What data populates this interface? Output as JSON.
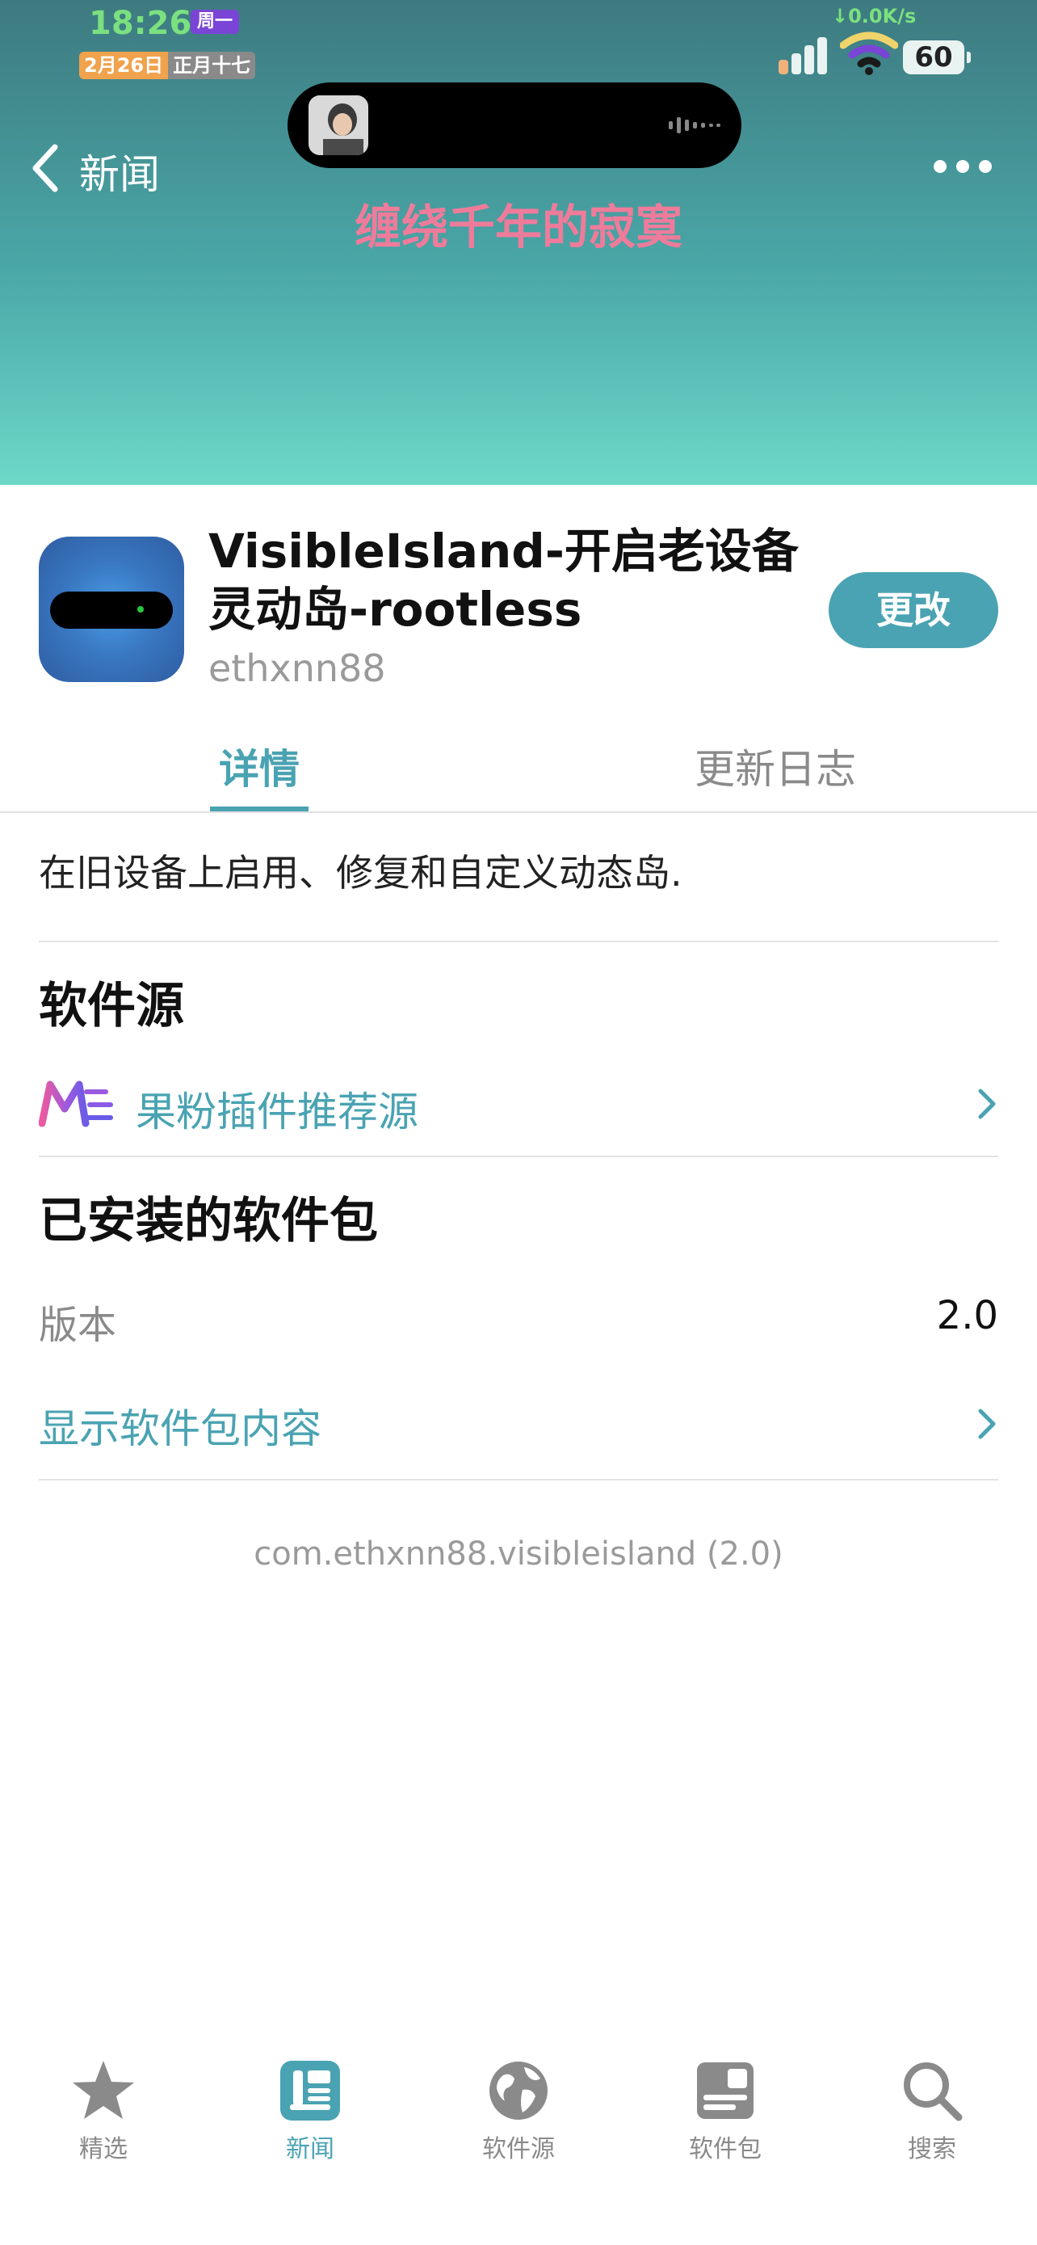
{
  "status_bar": {
    "time": "18:26",
    "weekday": "周一",
    "date": "2月26日",
    "lunar_date": "正月十七",
    "net_speed": "↓0.0K/s",
    "battery": "60"
  },
  "nav": {
    "back_label": "新闻",
    "more_icon": "more-icon",
    "banner_text": "缠绕千年的寂寞"
  },
  "package": {
    "title": "VisibleIsland-开启老设备灵动岛-rootless",
    "author": "ethxnn88",
    "modify_label": "更改"
  },
  "tabs": {
    "details": "详情",
    "changelog": "更新日志"
  },
  "description": "在旧设备上启用、修复和自定义动态岛.",
  "repo_section": {
    "title": "软件源",
    "repo_name": "果粉插件推荐源"
  },
  "installed_section": {
    "title": "已安装的软件包",
    "version_label": "版本",
    "version_value": "2.0",
    "show_contents": "显示软件包内容"
  },
  "package_id": "com.ethxnn88.visibleisland (2.0)",
  "tabbar": {
    "items": [
      {
        "label": "精选",
        "icon": "star-icon"
      },
      {
        "label": "新闻",
        "icon": "newspaper-icon"
      },
      {
        "label": "软件源",
        "icon": "globe-icon"
      },
      {
        "label": "软件包",
        "icon": "package-icon"
      },
      {
        "label": "搜索",
        "icon": "search-icon"
      }
    ],
    "active": "新闻"
  },
  "colors": {
    "accent": "#4aa3b2",
    "banner_text": "#ef7b9b",
    "hero_top": "#3d7a80",
    "hero_bottom": "#6dd8c8"
  }
}
